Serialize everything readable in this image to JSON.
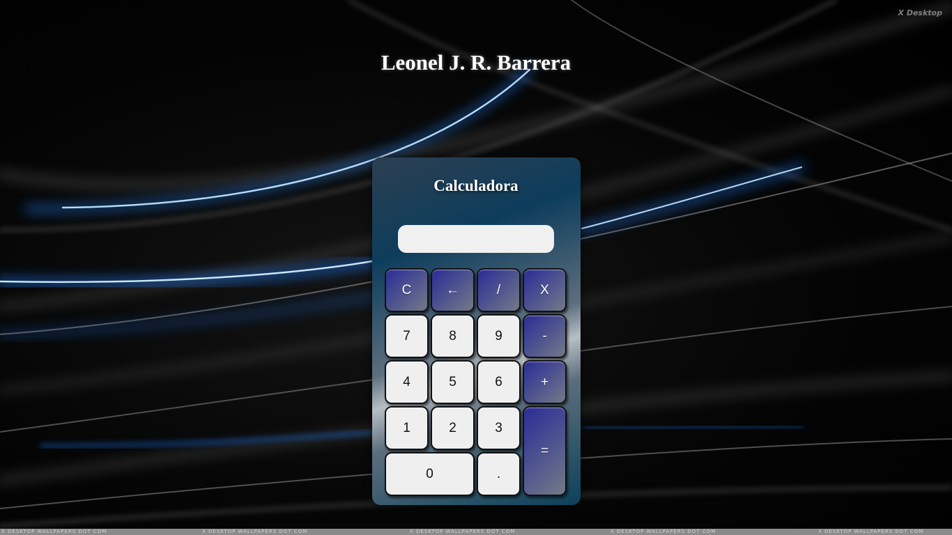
{
  "page": {
    "author_name": "Leonel J. R. Barrera",
    "wallpaper_logo": "X Desktop",
    "wallpaper_watermark": "X Desktop Wallpapers Dot Com"
  },
  "calculator": {
    "title": "Calculadora",
    "display_value": "",
    "keys": {
      "clear": "C",
      "backspace": "←",
      "divide": "/",
      "multiply": "X",
      "seven": "7",
      "eight": "8",
      "nine": "9",
      "minus": "-",
      "four": "4",
      "five": "5",
      "six": "6",
      "plus": "+",
      "one": "1",
      "two": "2",
      "three": "3",
      "equals": "=",
      "zero": "0",
      "decimal": "."
    }
  },
  "colors": {
    "operator_key": "#2b2c96",
    "number_key": "#efefef",
    "display_bg": "#f0f0f0",
    "panel": "#0d3d5c"
  }
}
